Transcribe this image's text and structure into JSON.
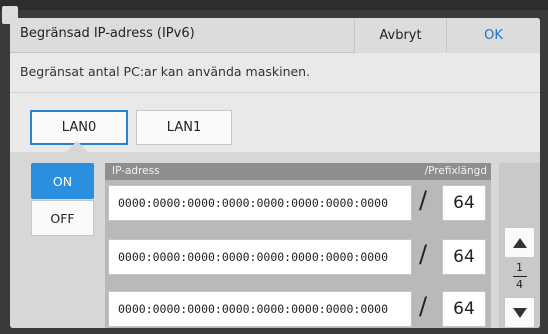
{
  "dialog": {
    "title": "Begränsad IP-adress (IPv6)",
    "cancel_label": "Avbryt",
    "ok_label": "OK",
    "description": "Begränsat antal PC:ar kan använda maskinen."
  },
  "tabs": [
    {
      "label": "LAN0",
      "selected": true
    },
    {
      "label": "LAN1",
      "selected": false
    }
  ],
  "toggle": {
    "on_label": "ON",
    "off_label": "OFF",
    "selected": "ON"
  },
  "list": {
    "header_ip": "IP-adress",
    "header_prefix": "/Prefixlängd",
    "separator": "/",
    "rows": [
      {
        "ip": "0000:0000:0000:0000:0000:0000:0000:0000",
        "prefix": "64"
      },
      {
        "ip": "0000:0000:0000:0000:0000:0000:0000:0000",
        "prefix": "64"
      },
      {
        "ip": "0000:0000:0000:0000:0000:0000:0000:0000",
        "prefix": "64"
      }
    ]
  },
  "pagination": {
    "current": "1",
    "total": "4"
  },
  "colors": {
    "accent": "#2b8fe0",
    "ok_text": "#1f74c7"
  },
  "icons": {
    "scroll_up": "triangle-up-icon",
    "scroll_down": "triangle-down-icon"
  }
}
